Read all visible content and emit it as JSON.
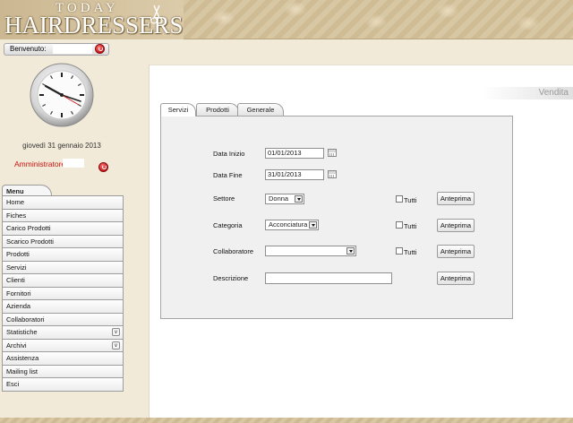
{
  "brand": {
    "top_word": "TODAY",
    "main_word": "HAIRDRESSERS"
  },
  "welcome": {
    "label": "Benvenuto:"
  },
  "date": "giovedì 31 gennaio 2013",
  "admin_label": "Amministratore :",
  "menu": {
    "title": "Menu",
    "items": [
      {
        "label": "Home"
      },
      {
        "label": "Fiches"
      },
      {
        "label": "Carico Prodotti"
      },
      {
        "label": "Scarico Prodotti"
      },
      {
        "label": "Prodotti"
      },
      {
        "label": "Servizi"
      },
      {
        "label": "Clienti"
      },
      {
        "label": "Fornitori"
      },
      {
        "label": "Azienda"
      },
      {
        "label": "Collaboratori"
      },
      {
        "label": "Statistiche",
        "expandable": true
      },
      {
        "label": "Archivi",
        "expandable": true
      },
      {
        "label": "Assistenza"
      },
      {
        "label": "Mailing list"
      },
      {
        "label": "Esci"
      }
    ]
  },
  "section_title": "Vendita",
  "tabs": [
    {
      "label": "Servizi",
      "active": true
    },
    {
      "label": "Prodotti",
      "active": false
    },
    {
      "label": "Generale",
      "active": false
    }
  ],
  "form": {
    "data_inizio": {
      "label": "Data Inizio",
      "value": "01/01/2013"
    },
    "data_fine": {
      "label": "Data Fine",
      "value": "31/01/2013"
    },
    "settore": {
      "label": "Settore",
      "value": "Donna"
    },
    "categoria": {
      "label": "Categoria",
      "value": "Acconciatura"
    },
    "collaboratore": {
      "label": "Collaboratore",
      "value": ""
    },
    "descrizione": {
      "label": "Descrizione",
      "value": ""
    },
    "tutti_label": "Tutti",
    "preview_label": "Anteprima"
  },
  "colors": {
    "accent_red": "#cc1111",
    "header_tan": "#d8c7a3"
  }
}
